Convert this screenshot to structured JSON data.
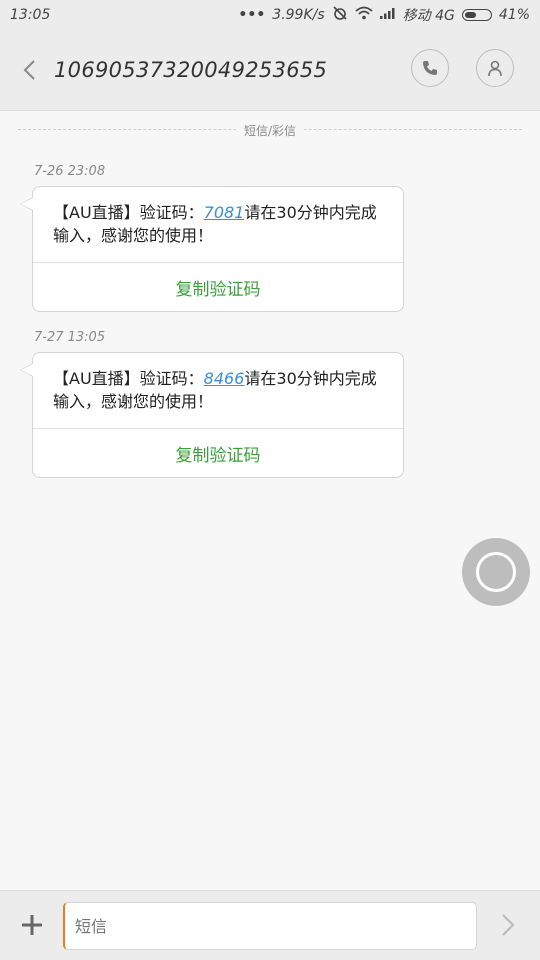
{
  "status_bar": {
    "time": "13:05",
    "network_speed": "3.99K/s",
    "carrier": "移动 4G",
    "battery": "41%"
  },
  "header": {
    "title": "10690537320049253655"
  },
  "divider_label": "短信/彩信",
  "messages": [
    {
      "timestamp": "7-26 23:08",
      "text_before": "【AU直播】验证码：",
      "code": "7081",
      "text_after": "请在30分钟内完成输入，感谢您的使用！",
      "action": "复制验证码"
    },
    {
      "timestamp": "7-27 13:05",
      "text_before": "【AU直播】验证码：",
      "code": "8466",
      "text_after": "请在30分钟内完成输入，感谢您的使用！",
      "action": "复制验证码"
    }
  ],
  "composer": {
    "placeholder": "短信"
  },
  "colors": {
    "accent_green": "#3aa03a",
    "link_blue": "#3a8fd9",
    "cursor_orange": "#e67e22"
  }
}
